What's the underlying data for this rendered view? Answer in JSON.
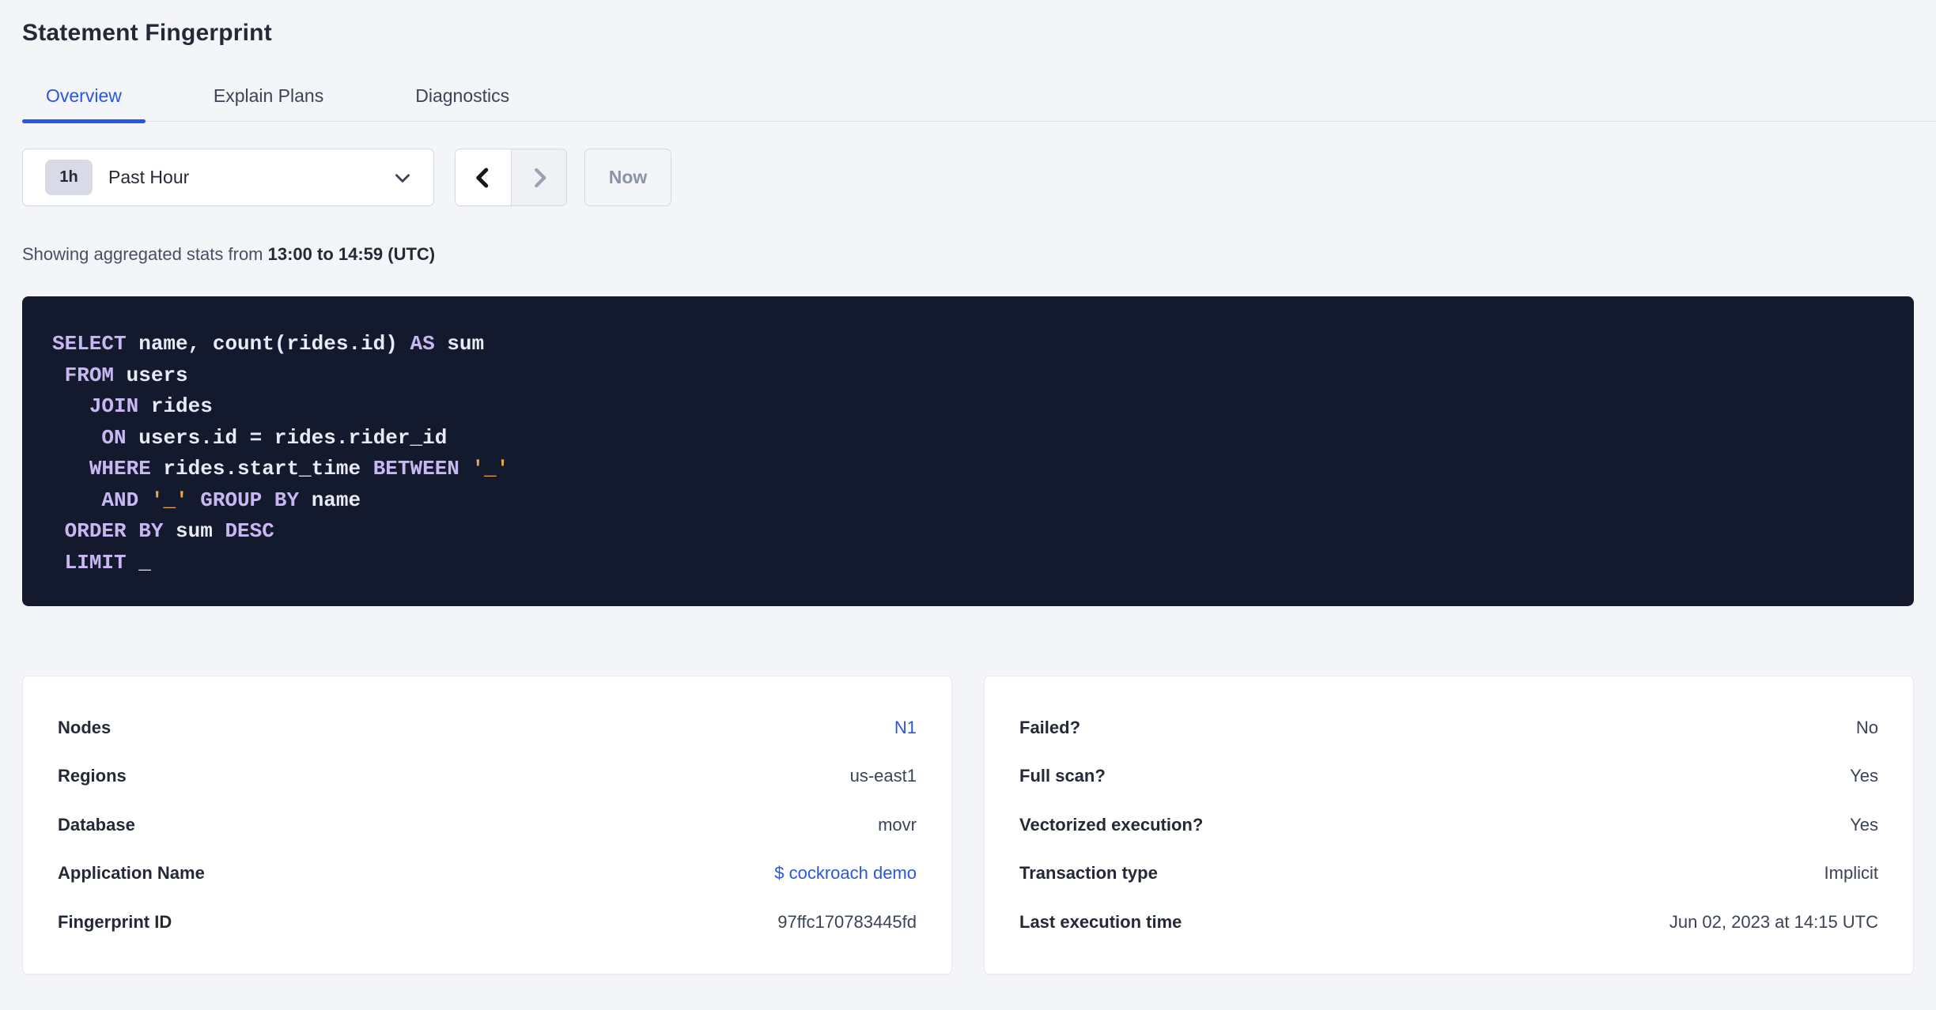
{
  "page": {
    "title": "Statement Fingerprint"
  },
  "tabs": [
    {
      "label": "Overview",
      "active": true
    },
    {
      "label": "Explain Plans",
      "active": false
    },
    {
      "label": "Diagnostics",
      "active": false
    }
  ],
  "time_picker": {
    "badge": "1h",
    "selected": "Past Hour",
    "now_label": "Now"
  },
  "stats_line": {
    "prefix": "Showing aggregated stats from ",
    "range": "13:00 to 14:59 (UTC)"
  },
  "sql": {
    "lines": [
      [
        {
          "t": "SELECT",
          "c": "kw"
        },
        {
          "t": " name, count(rides.id) ",
          "c": "pl"
        },
        {
          "t": "AS",
          "c": "kw"
        },
        {
          "t": " sum",
          "c": "pl"
        }
      ],
      [
        {
          "t": " ",
          "c": "pl"
        },
        {
          "t": "FROM",
          "c": "kw"
        },
        {
          "t": " users",
          "c": "pl"
        }
      ],
      [
        {
          "t": "   ",
          "c": "pl"
        },
        {
          "t": "JOIN",
          "c": "kw"
        },
        {
          "t": " rides",
          "c": "pl"
        }
      ],
      [
        {
          "t": "    ",
          "c": "pl"
        },
        {
          "t": "ON",
          "c": "kw"
        },
        {
          "t": " users.id = rides.rider_id",
          "c": "pl"
        }
      ],
      [
        {
          "t": "   ",
          "c": "pl"
        },
        {
          "t": "WHERE",
          "c": "kw"
        },
        {
          "t": " rides.start_time ",
          "c": "pl"
        },
        {
          "t": "BETWEEN",
          "c": "kw"
        },
        {
          "t": " ",
          "c": "pl"
        },
        {
          "t": "'_'",
          "c": "lit"
        }
      ],
      [
        {
          "t": "    ",
          "c": "pl"
        },
        {
          "t": "AND",
          "c": "kw"
        },
        {
          "t": " ",
          "c": "pl"
        },
        {
          "t": "'_'",
          "c": "lit"
        },
        {
          "t": " ",
          "c": "pl"
        },
        {
          "t": "GROUP BY",
          "c": "kw"
        },
        {
          "t": " name",
          "c": "pl"
        }
      ],
      [
        {
          "t": " ",
          "c": "pl"
        },
        {
          "t": "ORDER BY",
          "c": "kw"
        },
        {
          "t": " sum ",
          "c": "pl"
        },
        {
          "t": "DESC",
          "c": "kw"
        }
      ],
      [
        {
          "t": " ",
          "c": "pl"
        },
        {
          "t": "LIMIT",
          "c": "kw"
        },
        {
          "t": " _",
          "c": "pl"
        }
      ]
    ]
  },
  "cards": {
    "left": {
      "rows": [
        {
          "label": "Nodes",
          "value": "N1",
          "link": true
        },
        {
          "label": "Regions",
          "value": "us-east1",
          "link": false
        },
        {
          "label": "Database",
          "value": "movr",
          "link": false
        },
        {
          "label": "Application Name",
          "value": "$ cockroach demo",
          "link": true
        },
        {
          "label": "Fingerprint ID",
          "value": "97ffc170783445fd",
          "link": false
        }
      ]
    },
    "right": {
      "rows": [
        {
          "label": "Failed?",
          "value": "No",
          "link": false
        },
        {
          "label": "Full scan?",
          "value": "Yes",
          "link": false
        },
        {
          "label": "Vectorized execution?",
          "value": "Yes",
          "link": false
        },
        {
          "label": "Transaction type",
          "value": "Implicit",
          "link": false
        },
        {
          "label": "Last execution time",
          "value": "Jun 02, 2023 at 14:15 UTC",
          "link": false
        }
      ]
    }
  },
  "colors": {
    "accent_blue": "#2a56e0",
    "page_background": "#f4f5f9",
    "sql_background": "#141a2d",
    "sql_keyword": "#c8b8f2",
    "sql_literal": "#eea64b",
    "sql_text": "#e9eaf4"
  },
  "icons": {
    "dropdown_caret": "chevron-down",
    "prev_arrow": "chevron-left",
    "next_arrow": "chevron-right"
  }
}
